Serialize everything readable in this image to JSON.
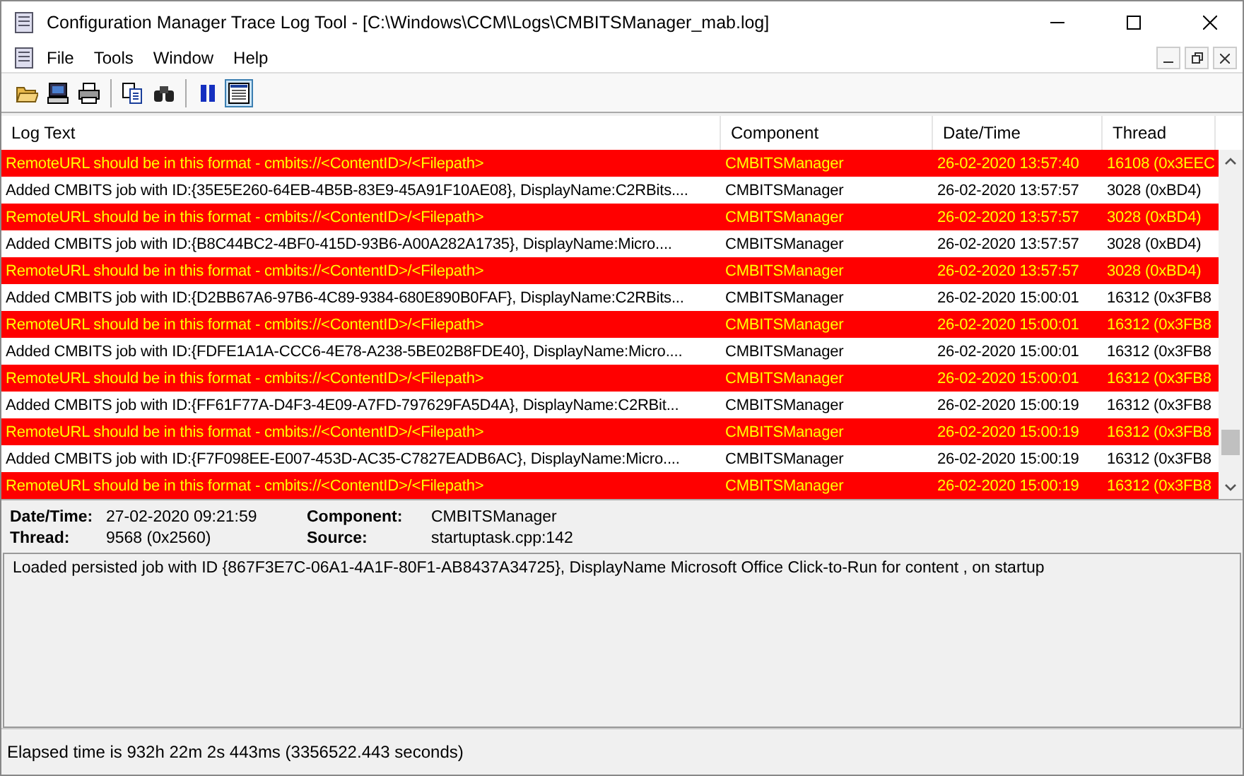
{
  "window": {
    "title": "Configuration Manager Trace Log Tool - [C:\\Windows\\CCM\\Logs\\CMBITSManager_mab.log]"
  },
  "menu": [
    "File",
    "Tools",
    "Window",
    "Help"
  ],
  "toolbar": [
    [
      {
        "pressed": false
      },
      {
        "pressed": false
      },
      {
        "pressed": false
      }
    ],
    [
      {
        "pressed": false
      },
      {
        "pressed": false
      }
    ],
    [
      {
        "pressed": false
      },
      {
        "pressed": true
      }
    ]
  ],
  "table": {
    "columns": [
      "Log Text",
      "Component",
      "Date/Time",
      "Thread"
    ],
    "rows": [
      {
        "kind": "error",
        "cells": [
          "RemoteURL should be in this format - cmbits://<ContentID>/<Filepath>",
          "CMBITSManager",
          "26-02-2020 13:57:40",
          "16108 (0x3EEC"
        ]
      },
      {
        "kind": "info",
        "cells": [
          "Added CMBITS job with ID:{35E5E260-64EB-4B5B-83E9-45A91F10AE08}, DisplayName:C2RBits....",
          "CMBITSManager",
          "26-02-2020 13:57:57",
          "3028 (0xBD4)"
        ]
      },
      {
        "kind": "error",
        "cells": [
          "RemoteURL should be in this format - cmbits://<ContentID>/<Filepath>",
          "CMBITSManager",
          "26-02-2020 13:57:57",
          "3028 (0xBD4)"
        ]
      },
      {
        "kind": "info",
        "cells": [
          "Added CMBITS job with ID:{B8C44BC2-4BF0-415D-93B6-A00A282A1735}, DisplayName:Micro....",
          "CMBITSManager",
          "26-02-2020 13:57:57",
          "3028 (0xBD4)"
        ]
      },
      {
        "kind": "error",
        "cells": [
          "RemoteURL should be in this format - cmbits://<ContentID>/<Filepath>",
          "CMBITSManager",
          "26-02-2020 13:57:57",
          "3028 (0xBD4)"
        ]
      },
      {
        "kind": "info",
        "cells": [
          "Added CMBITS job with ID:{D2BB67A6-97B6-4C89-9384-680E890B0FAF}, DisplayName:C2RBits...",
          "CMBITSManager",
          "26-02-2020 15:00:01",
          "16312 (0x3FB8"
        ]
      },
      {
        "kind": "error",
        "cells": [
          "RemoteURL should be in this format - cmbits://<ContentID>/<Filepath>",
          "CMBITSManager",
          "26-02-2020 15:00:01",
          "16312 (0x3FB8"
        ]
      },
      {
        "kind": "info",
        "cells": [
          "Added CMBITS job with ID:{FDFE1A1A-CCC6-4E78-A238-5BE02B8FDE40}, DisplayName:Micro....",
          "CMBITSManager",
          "26-02-2020 15:00:01",
          "16312 (0x3FB8"
        ]
      },
      {
        "kind": "error",
        "cells": [
          "RemoteURL should be in this format - cmbits://<ContentID>/<Filepath>",
          "CMBITSManager",
          "26-02-2020 15:00:01",
          "16312 (0x3FB8"
        ]
      },
      {
        "kind": "info",
        "cells": [
          "Added CMBITS job with ID:{FF61F77A-D4F3-4E09-A7FD-797629FA5D4A}, DisplayName:C2RBit...",
          "CMBITSManager",
          "26-02-2020 15:00:19",
          "16312 (0x3FB8"
        ]
      },
      {
        "kind": "error",
        "cells": [
          "RemoteURL should be in this format - cmbits://<ContentID>/<Filepath>",
          "CMBITSManager",
          "26-02-2020 15:00:19",
          "16312 (0x3FB8"
        ]
      },
      {
        "kind": "info",
        "cells": [
          "Added CMBITS job with ID:{F7F098EE-E007-453D-AC35-C7827EADB6AC}, DisplayName:Micro....",
          "CMBITSManager",
          "26-02-2020 15:00:19",
          "16312 (0x3FB8"
        ]
      },
      {
        "kind": "error",
        "cells": [
          "RemoteURL should be in this format - cmbits://<ContentID>/<Filepath>",
          "CMBITSManager",
          "26-02-2020 15:00:19",
          "16312 (0x3FB8"
        ]
      }
    ]
  },
  "details": [
    {
      "label": "Date/Time:",
      "value": "27-02-2020 09:21:59"
    },
    {
      "label": "Component:",
      "value": "CMBITSManager"
    },
    {
      "label": "Thread:",
      "value": "9568 (0x2560)"
    },
    {
      "label": "Source:",
      "value": "startuptask.cpp:142"
    }
  ],
  "message": "Loaded persisted job with ID {867F3E7C-06A1-4A1F-80F1-AB8437A34725}, DisplayName Microsoft Office Click-to-Run  for content , on startup",
  "status_bar": "Elapsed time is 932h 22m 2s 443ms (3356522.443 seconds)"
}
